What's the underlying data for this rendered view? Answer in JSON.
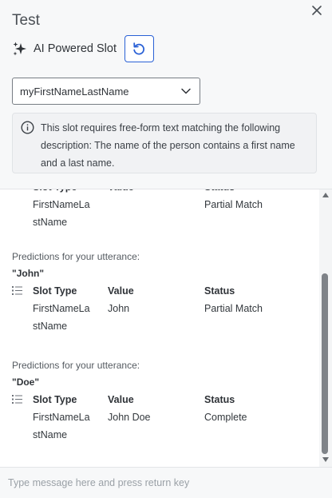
{
  "header": {
    "title": "Test",
    "ai_label": "AI Powered Slot",
    "selected_slot": "myFirstNameLastName",
    "info_text": "This slot requires free-form text matching the following description: The name of the person contains a first name and a last name."
  },
  "results": {
    "blocks": [
      {
        "predictions_label": "",
        "utterance": "",
        "columns": [
          "Slot Type",
          "Value",
          "Status"
        ],
        "row": {
          "slot_type_line1": "FirstNameLa",
          "slot_type_line2": "stName",
          "value": "",
          "status": "Partial Match"
        }
      },
      {
        "predictions_label": "Predictions for your utterance:",
        "utterance": "\"John\"",
        "columns": [
          "Slot Type",
          "Value",
          "Status"
        ],
        "row": {
          "slot_type_line1": "FirstNameLa",
          "slot_type_line2": "stName",
          "value": "John",
          "status": "Partial Match"
        }
      },
      {
        "predictions_label": "Predictions for your utterance:",
        "utterance": "\"Doe\"",
        "columns": [
          "Slot Type",
          "Value",
          "Status"
        ],
        "row": {
          "slot_type_line1": "FirstNameLa",
          "slot_type_line2": "stName",
          "value": "John Doe",
          "status": "Complete"
        }
      }
    ]
  },
  "footer": {
    "placeholder": "Type message here and press return key"
  },
  "icons": {
    "close": "close-icon",
    "sparkle": "sparkle-icon",
    "refresh": "refresh-icon",
    "chevron": "chevron-down-icon",
    "info": "info-icon",
    "list": "list-icon"
  },
  "colors": {
    "accent": "#2a61d6",
    "panel_bg": "#f7f8f9",
    "text": "#33383d"
  }
}
